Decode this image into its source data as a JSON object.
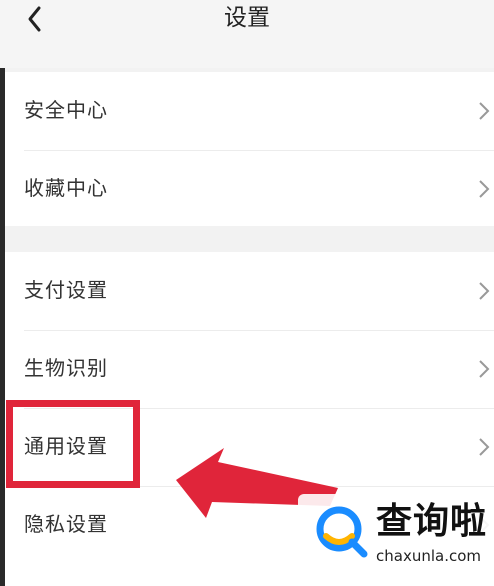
{
  "header": {
    "title": "设置",
    "back_icon": "chevron-left-icon"
  },
  "groups": [
    {
      "items": [
        {
          "label": "安全中心"
        },
        {
          "label": "收藏中心"
        }
      ]
    },
    {
      "items": [
        {
          "label": "支付设置"
        },
        {
          "label": "生物识别"
        },
        {
          "label": "通用设置"
        },
        {
          "label": "隐私设置"
        }
      ]
    }
  ],
  "annotation": {
    "highlighted_item": "通用设置",
    "color": "#e0253a"
  },
  "watermark": {
    "title": "查询啦",
    "subtitle": "chaxunla.com",
    "logo_colors": [
      "#1a8cff",
      "#ffb400"
    ]
  }
}
